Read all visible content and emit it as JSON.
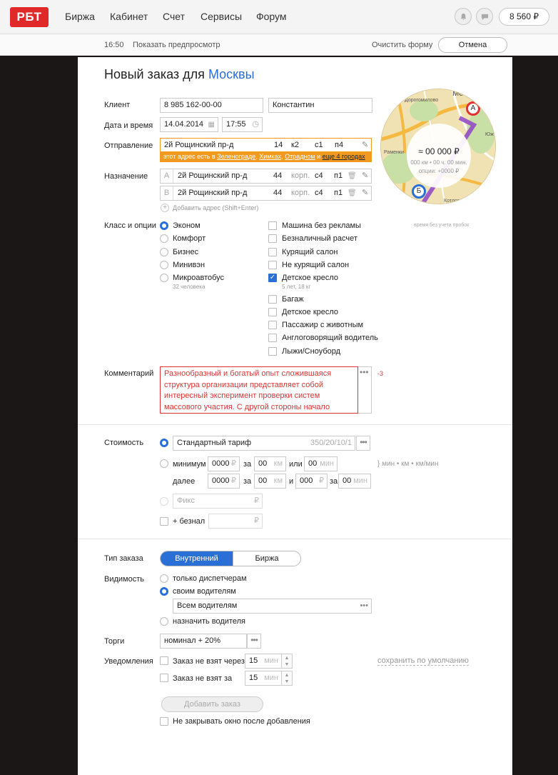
{
  "header": {
    "logo": "РБТ",
    "nav": [
      "Биржа",
      "Кабинет",
      "Счет",
      "Сервисы",
      "Форум"
    ],
    "balance": "8 560 ₽",
    "icons": [
      "bell-icon",
      "chat-icon"
    ]
  },
  "subbar": {
    "time": "16:50",
    "preview": "Показать предпросмотр",
    "clear": "Очистить форму",
    "cancel": "Отмена"
  },
  "form": {
    "title_prefix": "Новый заказ для",
    "title_city": "Москвы",
    "client_label": "Клиент",
    "client_phone": "8 985 162-00-00",
    "client_name": "Константин",
    "datetime_label": "Дата и время",
    "date": "14.04.2014",
    "time": "17:55",
    "departure_label": "Отправление",
    "departure": {
      "street": "2й Рощинский пр-д",
      "house": "14",
      "corp": "к2",
      "building": "с1",
      "entrance": "п4"
    },
    "departure_warn": {
      "text": "этот адрес есть в",
      "cities": [
        "Зеленограде",
        "Химках",
        "Отрадном"
      ],
      "and": "и",
      "more": "еще 4 городах"
    },
    "destination_label": "Назначение",
    "destinations": [
      {
        "letter": "A",
        "street": "2й Рощинский пр-д",
        "house": "44",
        "corp": "корп.",
        "building": "с4",
        "entrance": "п1"
      },
      {
        "letter": "B",
        "street": "2й Рощинский пр-д",
        "house": "44",
        "corp": "корп.",
        "building": "с4",
        "entrance": "п1"
      }
    ],
    "add_address": "Добавить адрес (Shift+Enter)",
    "class_label": "Класс и опции",
    "classes": [
      {
        "name": "Эконом",
        "selected": true
      },
      {
        "name": "Комфорт",
        "selected": false
      },
      {
        "name": "Бизнес",
        "selected": false
      },
      {
        "name": "Минивэн",
        "selected": false
      },
      {
        "name": "Микроавтобус",
        "selected": false,
        "note": "32 человека"
      }
    ],
    "options": [
      {
        "name": "Машина без рекламы",
        "checked": false
      },
      {
        "name": "Безналичный расчет",
        "checked": false
      },
      {
        "name": "Курящий салон",
        "checked": false
      },
      {
        "name": "Не курящий салон",
        "checked": false
      },
      {
        "name": "Детское кресло",
        "checked": true,
        "note": "5 лет, 18 кг"
      },
      {
        "name": "Багаж",
        "checked": false
      },
      {
        "name": "Детское кресло",
        "checked": false
      },
      {
        "name": "Пассажир с животным",
        "checked": false
      },
      {
        "name": "Англоговорящий водитель",
        "checked": false
      },
      {
        "name": "Лыжи/Сноуборд",
        "checked": false
      }
    ],
    "comment_label": "Комментарий",
    "comment_text": "Разнообразный и богатый опыт сложившаяся структура организации представляет собой интересный эксперимент проверки систем массового участия. С другой стороны начало",
    "comment_counter": "-3"
  },
  "map": {
    "price": "≈ 00 000 ₽",
    "meta": "000 км • 00 ч. 00 мин.",
    "options": "опции: +0000 ₽",
    "note": "время без учета пробок",
    "labels": [
      "Дорогомилово",
      "Раменки",
      "Котловка",
      "Мо",
      "Юж"
    ],
    "markers": [
      "А",
      "Б"
    ]
  },
  "cost": {
    "label": "Стоимость",
    "tariff": "Стандартный тариф",
    "tariff_code": "350/20/10/1",
    "min_label": "минимум",
    "min_rub": "0000",
    "za": "за",
    "min_km": "00",
    "km": "км",
    "ili": "или",
    "min_min": "00",
    "min": "мин",
    "units_note": "} мин • км • км/мин",
    "dalee": "далее",
    "next_rub": "0000",
    "next_km": "00",
    "and": "и",
    "next_rub2": "000",
    "next_min": "00",
    "fix": "Фикс",
    "cashless": "+ безнал",
    "rub_sign": "₽"
  },
  "order": {
    "type_label": "Тип заказа",
    "type_a": "Внутренний",
    "type_b": "Биржа",
    "visibility_label": "Видимость",
    "vis_only_disp": "только диспетчерам",
    "vis_own": "своим водителям",
    "vis_select": "Всем водителям",
    "vis_assign": "назначить водителя",
    "bid_label": "Торги",
    "bid_value": "номинал + 20%",
    "notify_label": "Уведомления",
    "notify1": "Заказ не взят через",
    "notify1_val": "15",
    "notify2": "Заказ не взят за",
    "notify2_val": "15",
    "min": "мин",
    "save_default": "сохранить по умолчанию",
    "submit": "Добавить заказ",
    "keep_open": "Не закрывать окно после добавления"
  },
  "colors": {
    "accent": "#2a6fd6",
    "brand": "#e02a2a",
    "warn": "#f29a1f",
    "error": "#e03232"
  }
}
